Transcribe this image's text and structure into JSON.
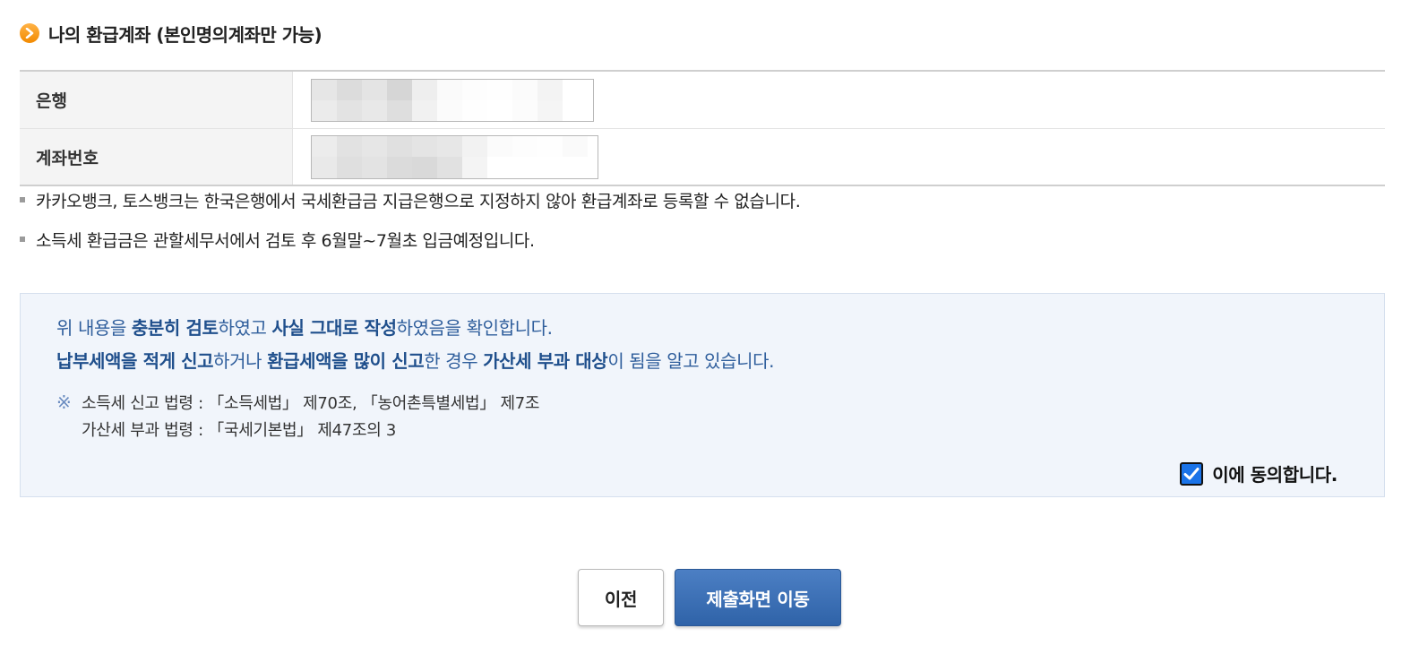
{
  "section": {
    "title": "나의 환급계좌 (본인명의계좌만 가능)",
    "icon": "chevron-right-circle-icon",
    "icon_color": "#f7a21b"
  },
  "account_form": {
    "bank_label": "은행",
    "account_number_label": "계좌번호"
  },
  "notes": [
    "카카오뱅크, 토스뱅크는 한국은행에서 국세환급금 지급은행으로 지정하지 않아 환급계좌로 등록할 수 없습니다.",
    "소득세 환급금은 관할세무서에서 검토 후 6월말~7월초 입금예정입니다."
  ],
  "confirmation": {
    "line1": {
      "t1": "위 내용을 ",
      "b1": "충분히 검토",
      "t2": "하였고 ",
      "b2": "사실 그대로 작성",
      "t3": "하였음을 확인합니다."
    },
    "line2": {
      "b1": "납부세액을 적게 신고",
      "t1": "하거나 ",
      "b2": "환급세액을 많이 신고",
      "t2": "한 경우 ",
      "b3": "가산세 부과 대상",
      "t3": "이 됨을 알고 있습니다."
    },
    "law_mark": "※",
    "law_line1": "소득세 신고 법령 : 「소득세법」 제70조, 「농어촌특별세법」 제7조",
    "law_line2": "가산세 부과 법령 : 「국세기본법」 제47조의 3",
    "agree_label": "이에 동의합니다.",
    "agree_checked": true,
    "accent_color": "#2f5e9c"
  },
  "buttons": {
    "prev_label": "이전",
    "submit_label": "제출화면 이동",
    "submit_color": "#3a6fb5"
  }
}
